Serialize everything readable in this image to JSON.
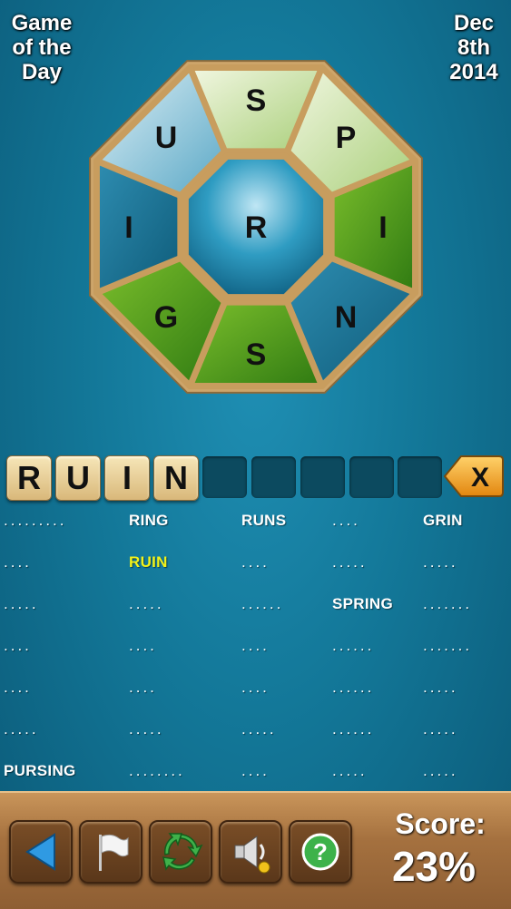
{
  "header": {
    "left_lines": [
      "Game",
      "of the",
      "Day"
    ],
    "right_lines": [
      "Dec",
      "8th",
      "2014"
    ]
  },
  "wheel": {
    "center": "R",
    "letters": [
      "S",
      "P",
      "I",
      "N",
      "S",
      "G",
      "I",
      "U"
    ]
  },
  "current_word": {
    "tiles": [
      "R",
      "U",
      "I",
      "N"
    ],
    "empty_slots": 5,
    "clear_label": "X"
  },
  "words": {
    "rows": [
      [
        ".........",
        "RING",
        "RUNS",
        "....",
        "GRIN"
      ],
      [
        "....",
        "RUIN",
        "....",
        ".....",
        "....."
      ],
      [
        ".....",
        ".....",
        "......",
        "SPRING",
        "......."
      ],
      [
        "....",
        "....",
        "....",
        "......",
        "......."
      ],
      [
        "....",
        "....",
        "....",
        "......",
        "....."
      ],
      [
        ".....",
        ".....",
        ".....",
        "......",
        "....."
      ],
      [
        "PURSING",
        "........",
        "....",
        ".....",
        "....."
      ]
    ],
    "highlighted": "RUIN"
  },
  "toolbar": {
    "buttons": [
      "back-icon",
      "flag-icon",
      "shuffle-icon",
      "sound-icon",
      "help-icon"
    ]
  },
  "score": {
    "label": "Score:",
    "value": "23%"
  },
  "colors": {
    "background": "#137899",
    "highlight": "#f2f21a",
    "wood": "#a5713f"
  }
}
